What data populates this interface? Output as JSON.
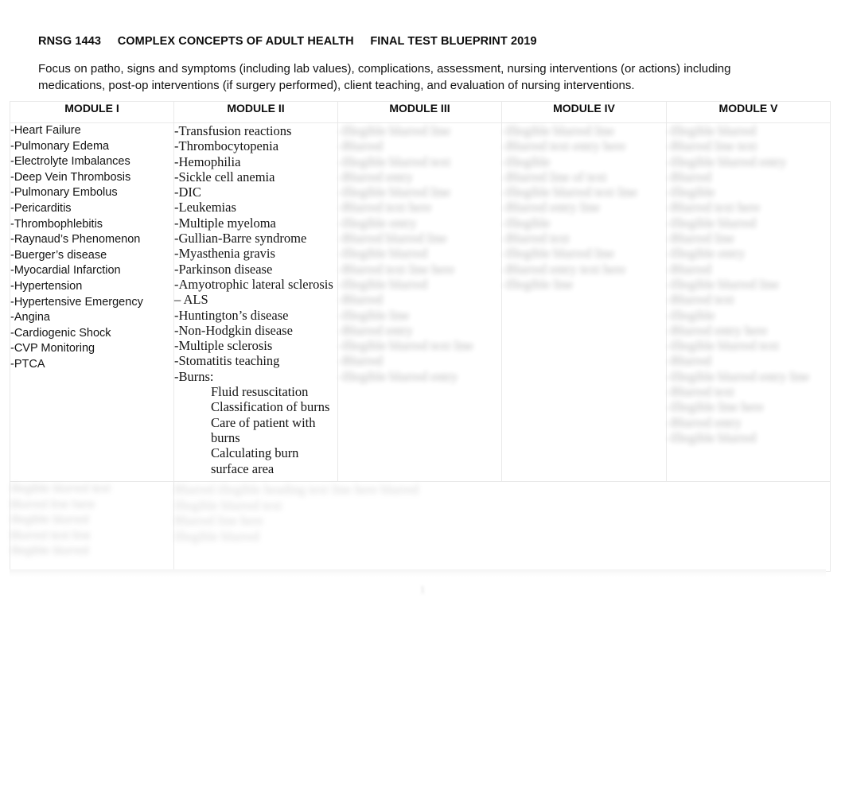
{
  "document": {
    "title_line": "RNSG 1443     COMPLEX CONCEPTS OF ADULT HEALTH     FINAL TEST BLUEPRINT 2019",
    "intro": "Focus on patho, signs and symptoms (including lab values), complications, assessment, nursing interventions (or actions) including medications, post-op interventions (if surgery performed), client teaching, and evaluation of nursing interventions.",
    "page_number": "1"
  },
  "table": {
    "headers": [
      "MODULE I",
      "MODULE II",
      "MODULE III",
      "MODULE IV",
      "MODULE V"
    ],
    "columns": [
      {
        "id": "module-1",
        "header": "MODULE I",
        "legible": true,
        "items": [
          "-Heart Failure",
          "-Pulmonary Edema",
          "-Electrolyte Imbalances",
          "-Deep Vein Thrombosis",
          "-Pulmonary Embolus",
          "-Pericarditis",
          "-Thrombophlebitis",
          "-Raynaud’s Phenomenon",
          "-Buerger’s disease",
          "-Myocardial Infarction",
          "-Hypertension",
          "-Hypertensive Emergency",
          "-Angina",
          "-Cardiogenic Shock",
          "-CVP Monitoring",
          "-PTCA"
        ],
        "sub_items": []
      },
      {
        "id": "module-2",
        "header": "MODULE II",
        "legible": true,
        "items": [
          "-Transfusion reactions",
          "-Thrombocytopenia",
          "-Hemophilia",
          "-Sickle cell anemia",
          "-DIC",
          "-Leukemias",
          "-Multiple myeloma",
          "-Gullian-Barre syndrome",
          "-Myasthenia gravis",
          "-Parkinson disease",
          "-Amyotrophic lateral sclerosis – ALS",
          "-Huntington’s disease",
          "-Non-Hodgkin disease",
          "-Multiple sclerosis",
          "-Stomatitis teaching",
          "-Burns:"
        ],
        "sub_items": [
          "Fluid resuscitation",
          "Classification of burns",
          "Care of patient with burns",
          "Calculating burn surface area"
        ]
      },
      {
        "id": "module-3",
        "header": "MODULE III",
        "legible": false,
        "items": [
          "-Illegible blurred line",
          "-Blurred",
          "-Illegible blurred text",
          "-Blurred entry",
          "-Illegible blurred line",
          "-Blurred text here",
          "-Illegible entry",
          "-Blurred blurred line",
          "-Illegible blurred",
          "-Blurred text line here",
          "-Illegible blurred",
          "-Blurred",
          "-Illegible line",
          "-Blurred entry",
          "-Illegible blurred text line",
          "-Blurred",
          "-Illegible blurred entry"
        ],
        "sub_items": []
      },
      {
        "id": "module-4",
        "header": "MODULE IV",
        "legible": false,
        "items": [
          "-Illegible blurred line",
          "-Blurred text entry here",
          "-Illegible",
          "-Blurred line of text",
          "-Illegible blurred text line",
          "-Blurred entry line",
          "-Illegible",
          "-Blurred text",
          "-Illegible blurred line",
          "-Blurred entry text here",
          "-Illegible line"
        ],
        "sub_items": []
      },
      {
        "id": "module-5",
        "header": "MODULE V",
        "legible": false,
        "items": [
          "-Illegible blurred",
          "-Blurred line text",
          "-Illegible blurred entry",
          "-Blurred",
          "-Illegible",
          "-Blurred text here",
          "-Illegible blurred",
          "-Blurred line",
          "-Illegible entry",
          "-Blurred",
          "-Illegible blurred line",
          "-Blurred text",
          "-Illegible",
          "-Blurred entry here",
          "-Illegible blurred text",
          "-Blurred",
          "-Illegible blurred entry line",
          "-Blurred text",
          "-Illegible line here",
          "-Blurred entry",
          "-Illegible blurred"
        ],
        "sub_items": []
      }
    ],
    "bottom_row": {
      "legible": false,
      "left_cell_lines": [
        "Illegible blurred text",
        "Blurred line here",
        "Illegible blurred",
        "Blurred text line",
        "Illegible blurred"
      ],
      "spanning_cell_lines": [
        "Blurred illegible heading text line here blurred",
        "Illegible blurred text",
        "Blurred line here",
        "Illegible blurred"
      ]
    }
  }
}
